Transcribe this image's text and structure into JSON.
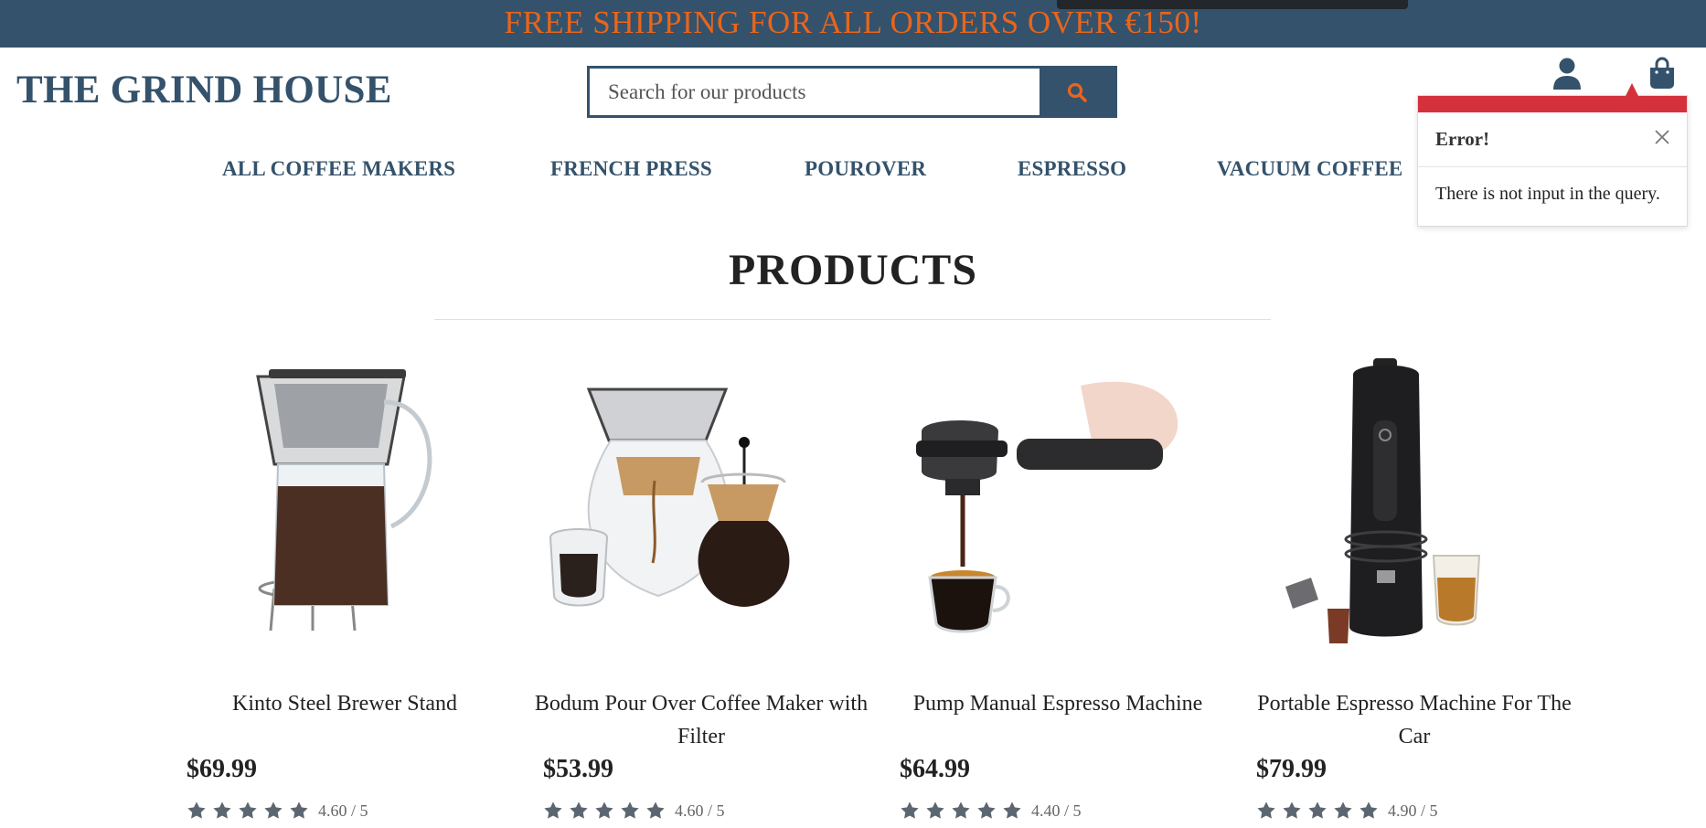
{
  "banner": {
    "text": "FREE SHIPPING FOR ALL ORDERS OVER €150!"
  },
  "header": {
    "logo": "THE GRIND HOUSE",
    "search_placeholder": "Search for our products",
    "icons": [
      "search-icon",
      "user-icon",
      "shopping-bag-icon"
    ]
  },
  "nav": {
    "items": [
      {
        "label": "ALL COFFEE MAKERS"
      },
      {
        "label": "FRENCH PRESS"
      },
      {
        "label": "POUROVER"
      },
      {
        "label": "ESPRESSO"
      },
      {
        "label": "VACUUM COFFEE"
      }
    ]
  },
  "toast": {
    "title": "Error!",
    "message": "There is not input in the query.",
    "close_icon": "close-icon"
  },
  "main": {
    "heading": "PRODUCTS",
    "products": [
      {
        "name": "Kinto Steel Brewer Stand",
        "price": "$69.99",
        "rating": "4.60 / 5",
        "stars": 5,
        "image": "pour-over-brewer-image"
      },
      {
        "name": "Bodum Pour Over Coffee Maker with Filter",
        "price": "$53.99",
        "rating": "4.60 / 5",
        "stars": 5,
        "image": "pour-over-set-image"
      },
      {
        "name": "Pump Manual Espresso Machine",
        "price": "$64.99",
        "rating": "4.40 / 5",
        "stars": 5,
        "image": "manual-espresso-image"
      },
      {
        "name": "Portable Espresso Machine For The Car",
        "price": "$79.99",
        "rating": "4.90 / 5",
        "stars": 5,
        "image": "portable-espresso-image"
      }
    ]
  },
  "colors": {
    "brand": "#34526b",
    "banner_text": "#e8651c",
    "error": "#d4313d",
    "star": "#5b6670"
  }
}
